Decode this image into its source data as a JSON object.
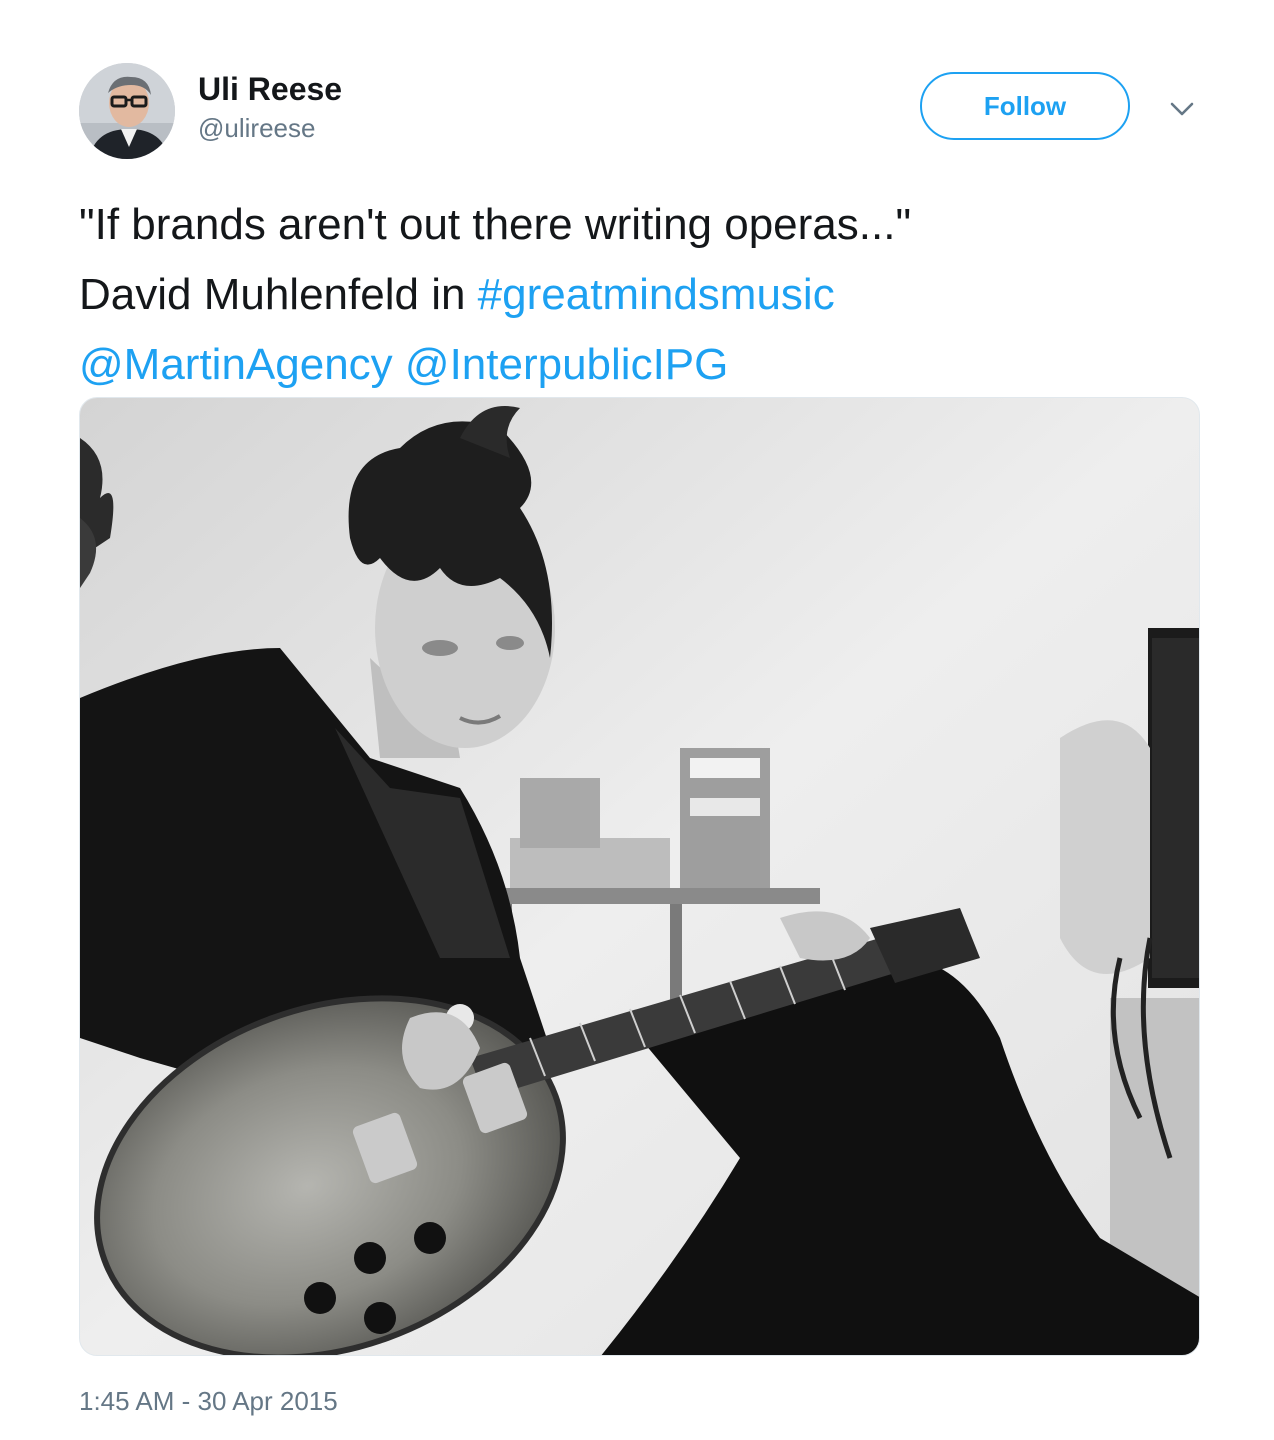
{
  "author": {
    "name": "Uli Reese",
    "handle": "@ulireese",
    "avatar_icon": "profile-photo"
  },
  "actions": {
    "follow_label": "Follow",
    "menu_icon": "chevron-down-icon"
  },
  "tweet": {
    "line1": "\"If brands aren't out there writing operas...\"",
    "line2_text": "David Muhlenfeld in ",
    "hashtag": "#greatmindsmusic",
    "mention1": "@MartinAgency",
    "mention2": "@InterpublicIPG"
  },
  "timestamp": "1:45 AM - 30 Apr 2015",
  "colors": {
    "accent": "#1da1f2",
    "text": "#14171a",
    "secondary": "#657786"
  }
}
